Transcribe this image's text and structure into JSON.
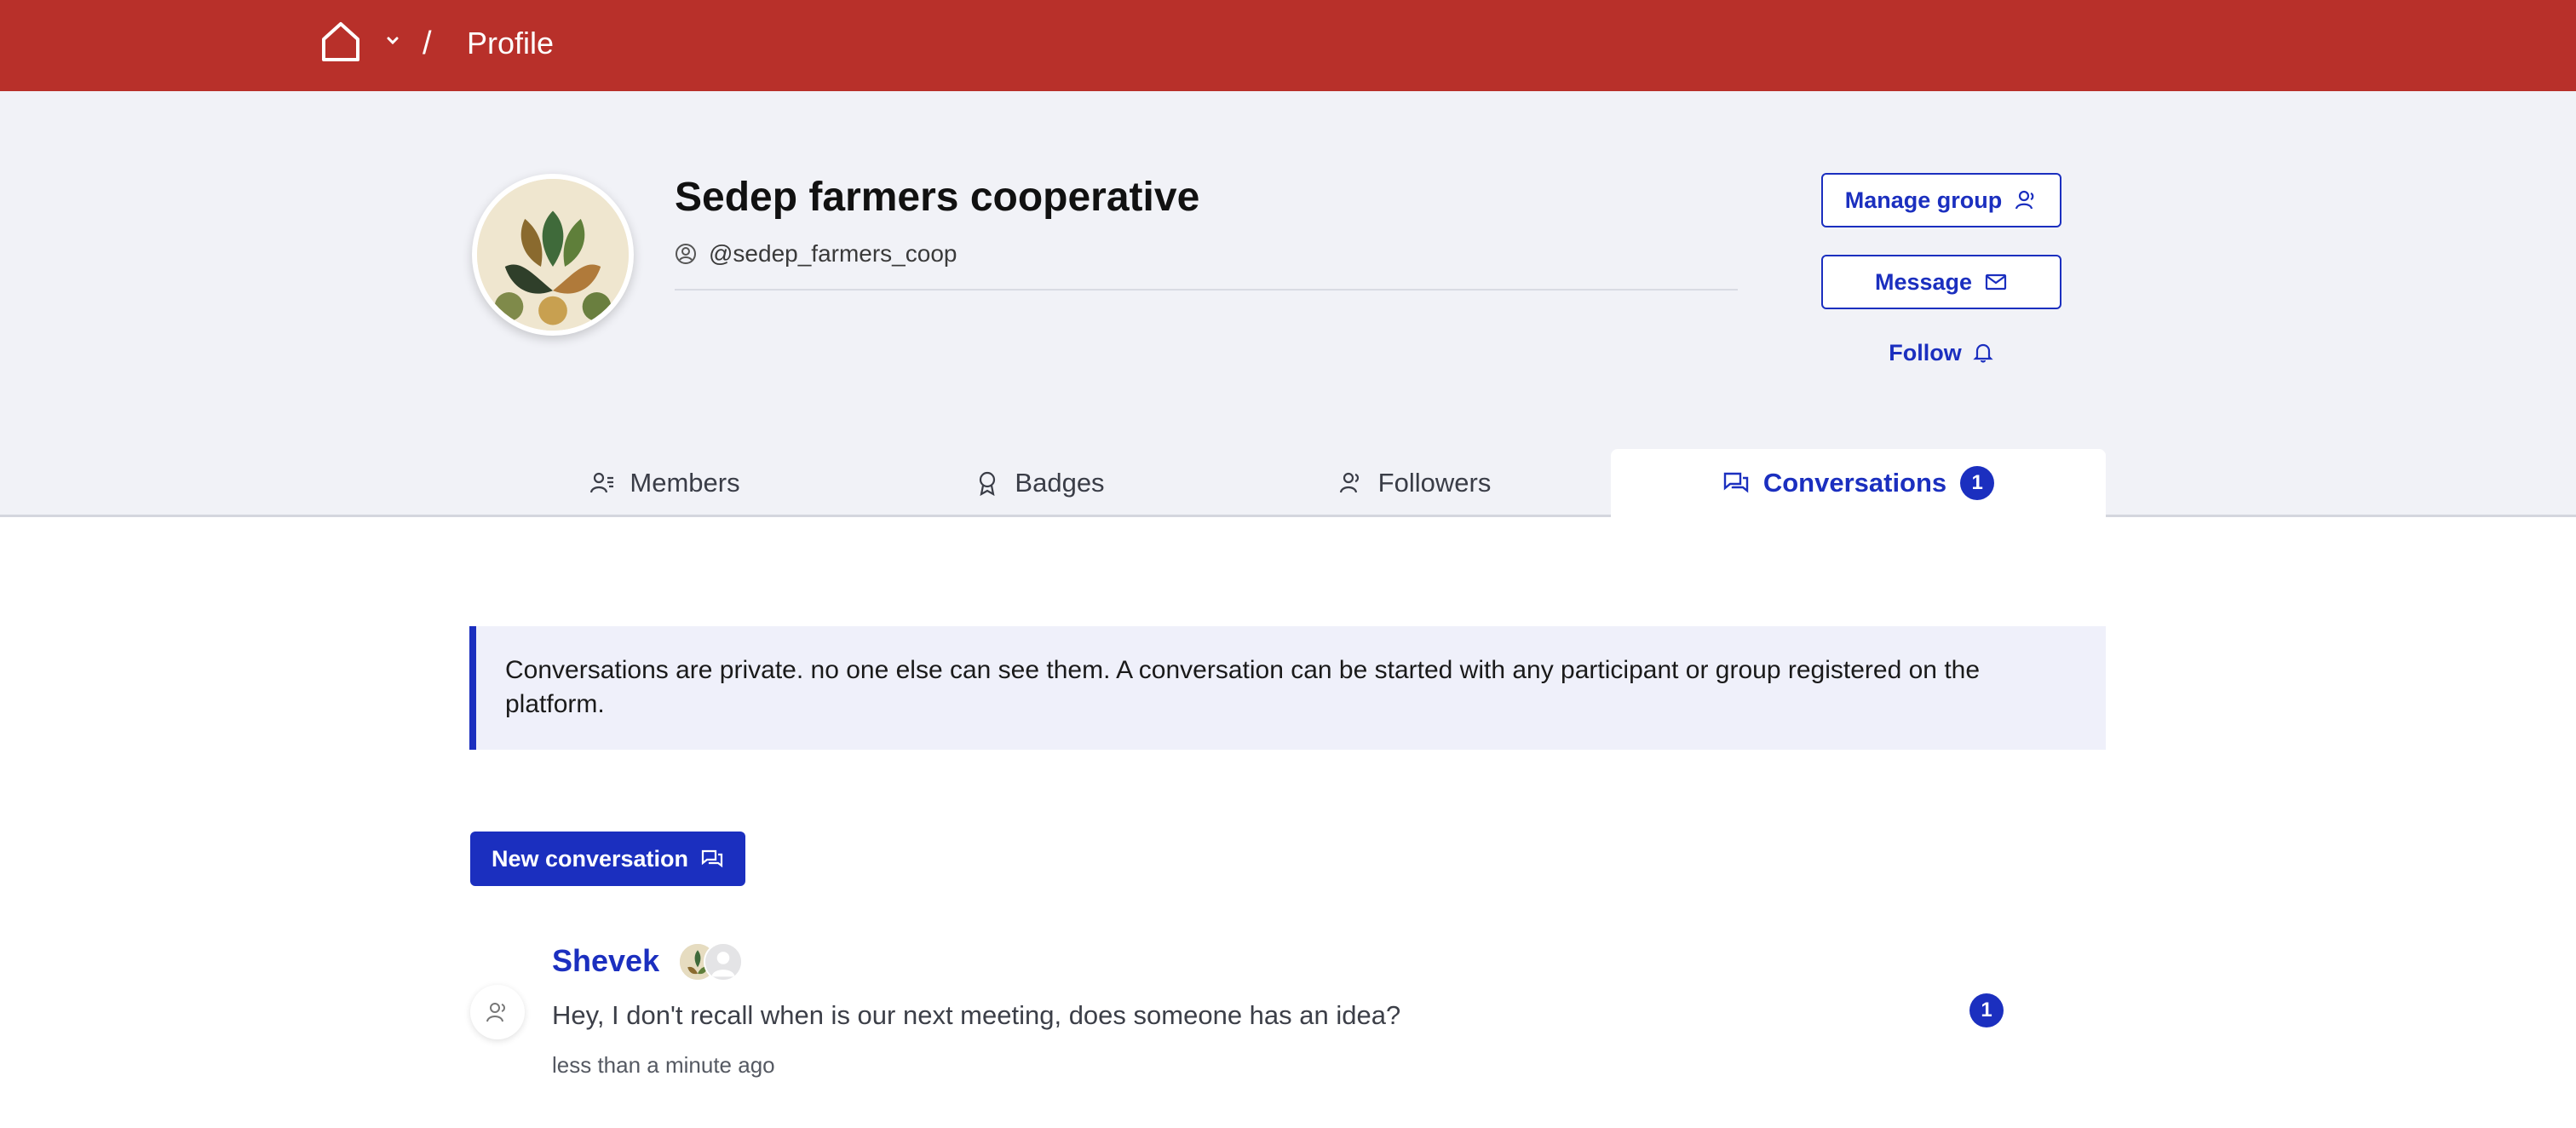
{
  "breadcrumb": {
    "separator": "/",
    "current": "Profile"
  },
  "profile": {
    "name": "Sedep farmers cooperative",
    "handle": "@sedep_farmers_coop"
  },
  "actions": {
    "manage_group": "Manage group",
    "message": "Message",
    "follow": "Follow"
  },
  "tabs": [
    {
      "label": "Members",
      "icon": "members-icon"
    },
    {
      "label": "Badges",
      "icon": "badge-icon"
    },
    {
      "label": "Followers",
      "icon": "followers-icon"
    },
    {
      "label": "Conversations",
      "icon": "conversations-icon",
      "count": "1",
      "active": true
    }
  ],
  "notice": "Conversations are private. no one else can see them. A conversation can be started with any participant or group registered on the platform.",
  "new_conversation": "New conversation",
  "conversations": [
    {
      "name": "Shevek",
      "message": "Hey, I don't recall when is our next meeting, does someone has an idea?",
      "time": "less than a minute ago",
      "unread": "1"
    }
  ],
  "colors": {
    "topbar": "#b8302a",
    "accent": "#1b2fbf",
    "header_bg": "#f1f2f7",
    "notice_bg": "#eff0fa"
  }
}
